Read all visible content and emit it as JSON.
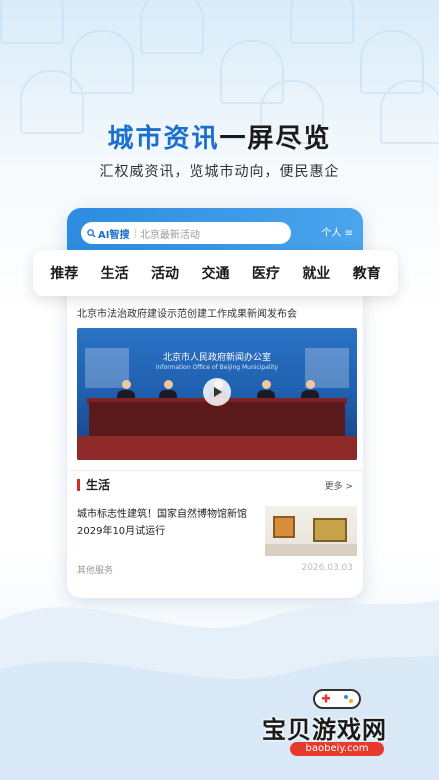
{
  "headline": {
    "part1": "城市资讯",
    "part2": "一屏尽览"
  },
  "subheadline": "汇权威资讯，览城市动向，便民惠企",
  "app": {
    "search": {
      "ai_label": "AI智搜",
      "placeholder": "北京最新活动"
    },
    "personal_label": "个人",
    "nav_tabs": [
      "推荐",
      "生活",
      "活动",
      "交通",
      "医疗",
      "就业",
      "教育"
    ],
    "news_headline": "北京市法治政府建设示范创建工作成果新闻发布会",
    "news_image": {
      "banner_cn": "北京市人民政府新闻办公室",
      "banner_en": "Information Office of Beijing Municipality"
    },
    "section": {
      "title": "生活",
      "more_label": "更多 >",
      "item": {
        "title": "城市标志性建筑！国家自然博物馆新馆2029年10月试运行",
        "source": "其他服务",
        "date": "2026.03.03"
      }
    }
  },
  "watermark": {
    "name": "宝贝游戏网",
    "url": "baobeiy.com"
  },
  "colors": {
    "accent": "#1a6fd0",
    "header_blue": "#2d8ce0",
    "section_bar": "#d42b2b",
    "watermark_red": "#e63a2e"
  }
}
